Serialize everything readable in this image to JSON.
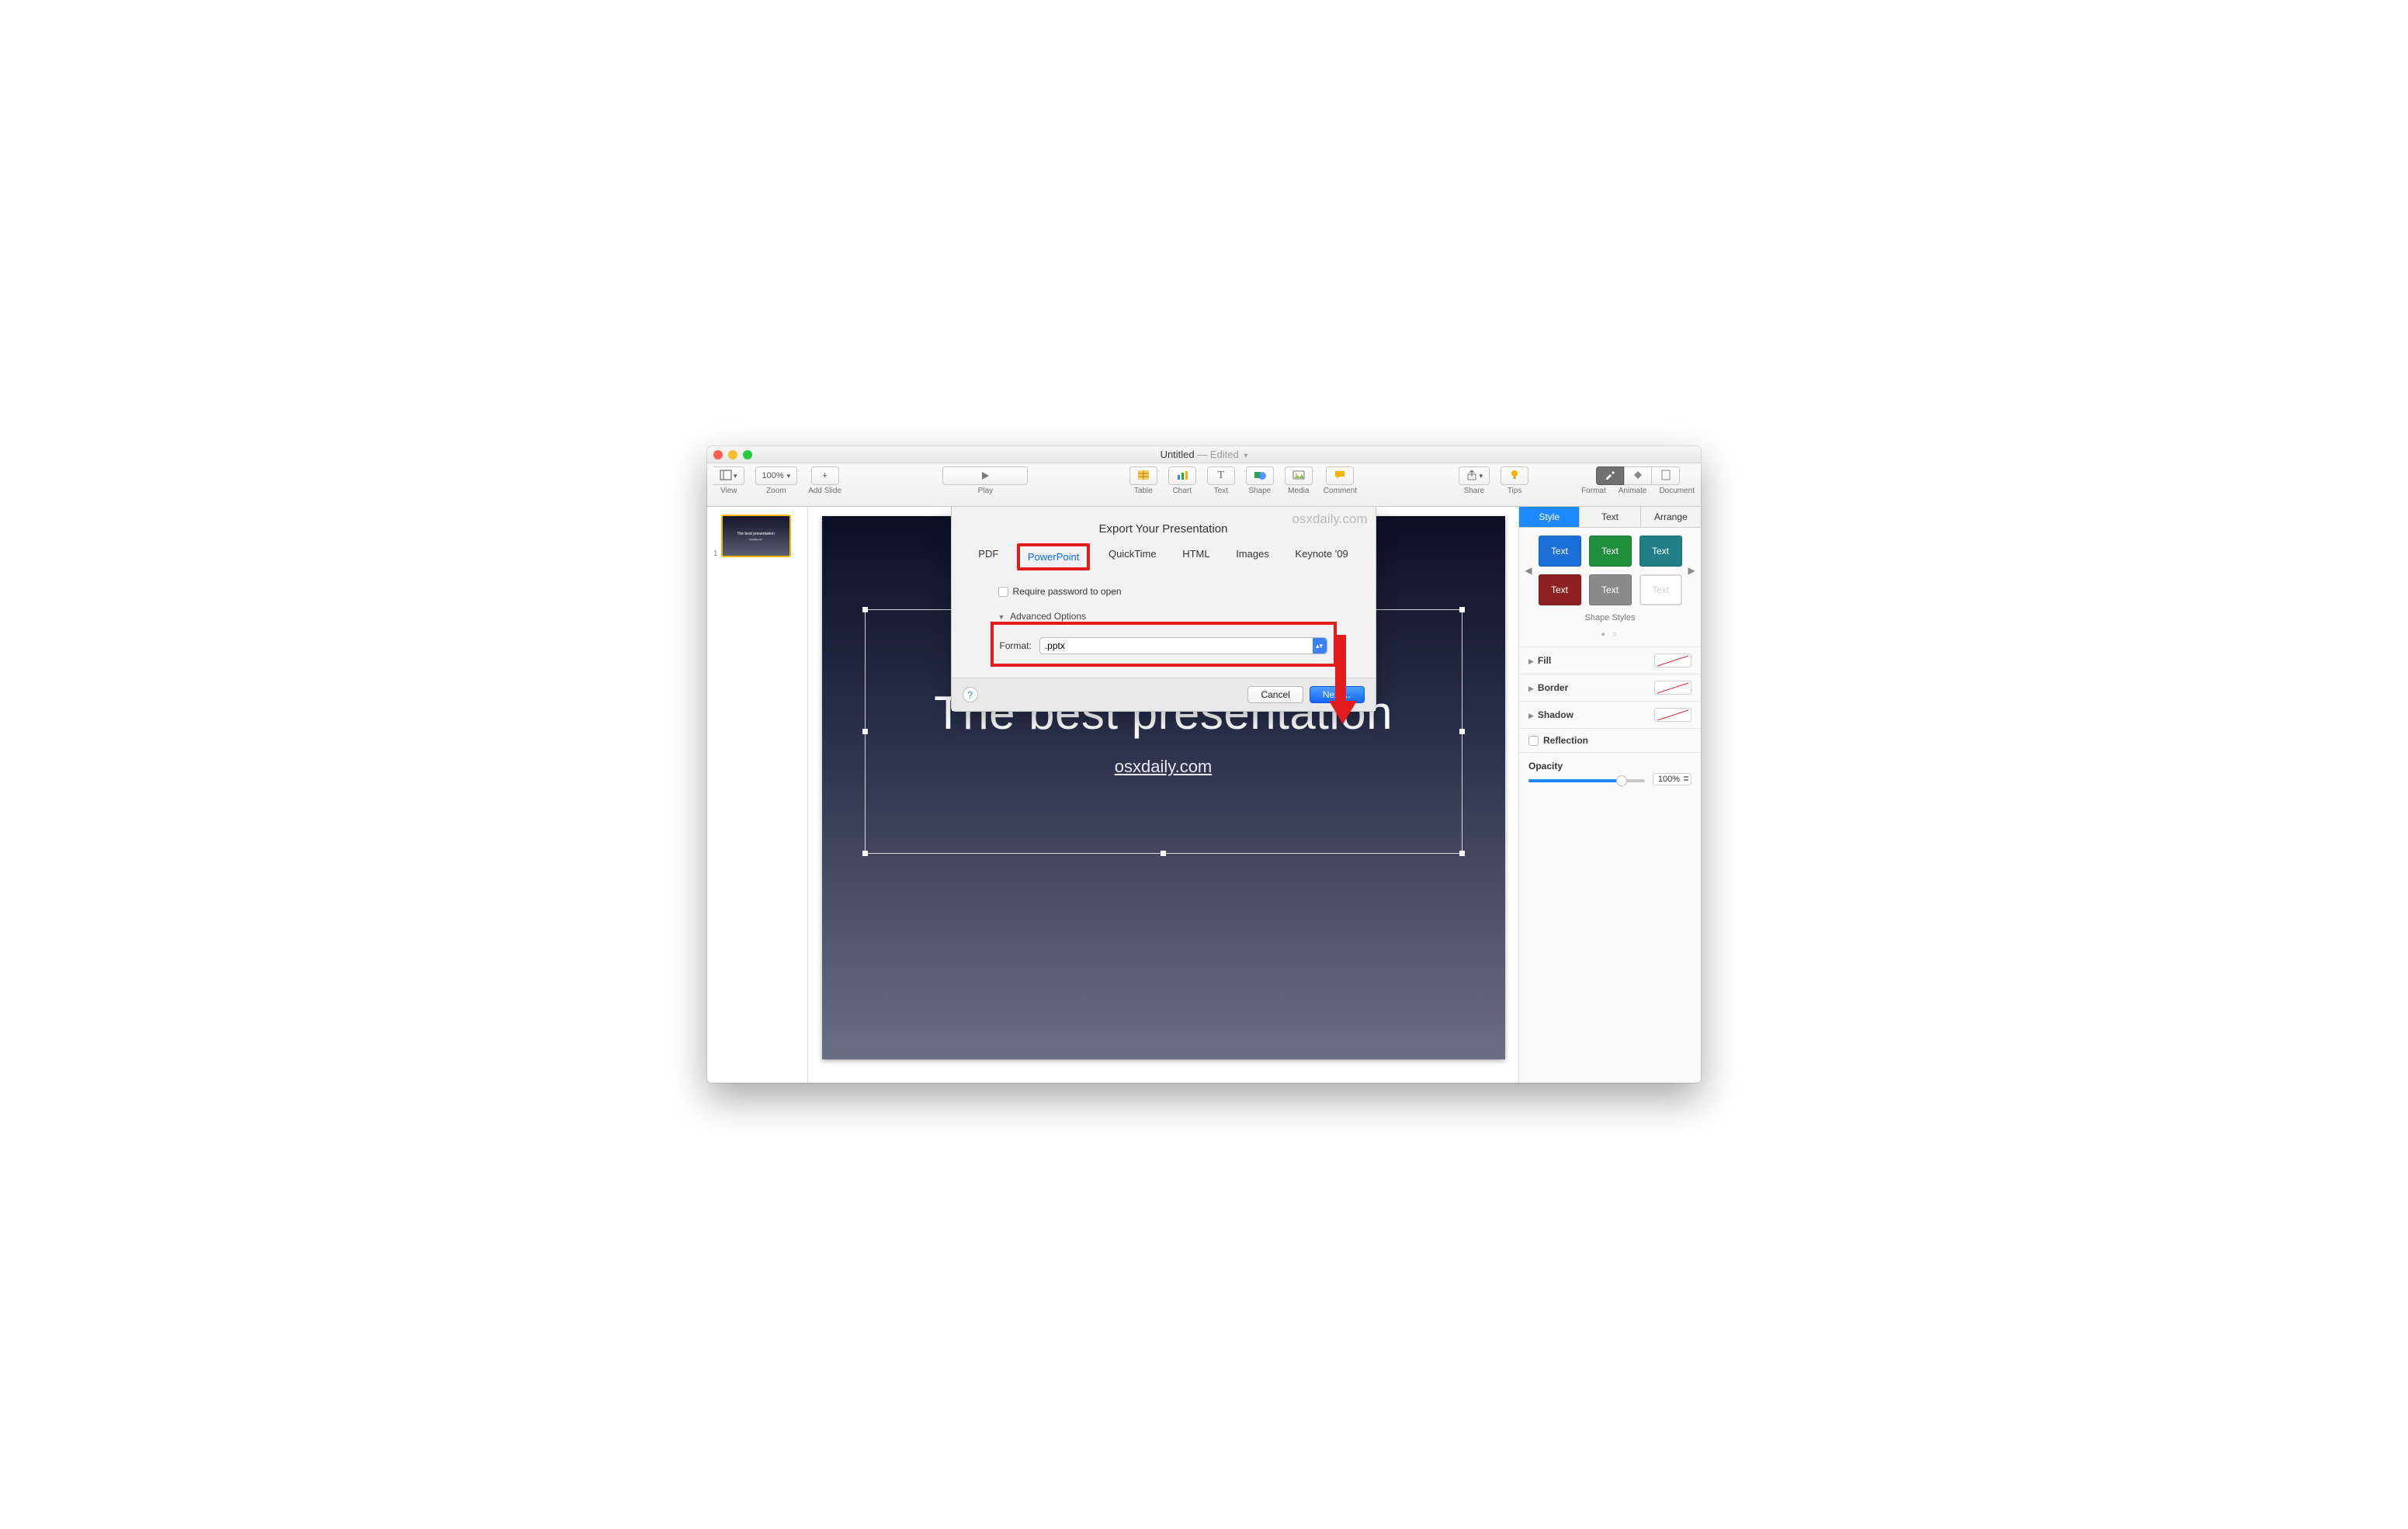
{
  "title": {
    "name": "Untitled",
    "state": "Edited"
  },
  "toolbar": {
    "view": "View",
    "zoom_value": "100%",
    "zoom": "Zoom",
    "add_slide": "Add Slide",
    "play": "Play",
    "table": "Table",
    "chart": "Chart",
    "text": "Text",
    "shape": "Shape",
    "media": "Media",
    "comment": "Comment",
    "share": "Share",
    "tips": "Tips",
    "format": "Format",
    "animate": "Animate",
    "document": "Document"
  },
  "navigator": {
    "slides": [
      {
        "index": "1",
        "title": "The best presentation",
        "subtitle": "osxdaily.com"
      }
    ]
  },
  "slide": {
    "title": "The best presentation",
    "subtitle": "osxdaily.com"
  },
  "export": {
    "watermark": "osxdaily.com",
    "heading": "Export Your Presentation",
    "tabs": [
      "PDF",
      "PowerPoint",
      "QuickTime",
      "HTML",
      "Images",
      "Keynote '09"
    ],
    "active_tab": "PowerPoint",
    "require_password": "Require password to open",
    "advanced": "Advanced Options",
    "format_label": "Format:",
    "format_value": ".pptx",
    "help": "?",
    "cancel": "Cancel",
    "next": "Next…"
  },
  "inspector": {
    "tabs": [
      "Style",
      "Text",
      "Arrange"
    ],
    "active_tab": "Style",
    "style_swatches": [
      {
        "label": "Text",
        "bg": "#1c6fd6"
      },
      {
        "label": "Text",
        "bg": "#1f8f3d"
      },
      {
        "label": "Text",
        "bg": "#1f7e86"
      },
      {
        "label": "Text",
        "bg": "#8e1f22"
      },
      {
        "label": "Text",
        "bg": "#8a8a8a"
      },
      {
        "label": "Text",
        "bg": "#ffffff",
        "fg": "#cfcfcf",
        "border": true
      }
    ],
    "shape_styles": "Shape Styles",
    "fill": "Fill",
    "border": "Border",
    "shadow": "Shadow",
    "reflection": "Reflection",
    "opacity_label": "Opacity",
    "opacity_value": "100%"
  }
}
